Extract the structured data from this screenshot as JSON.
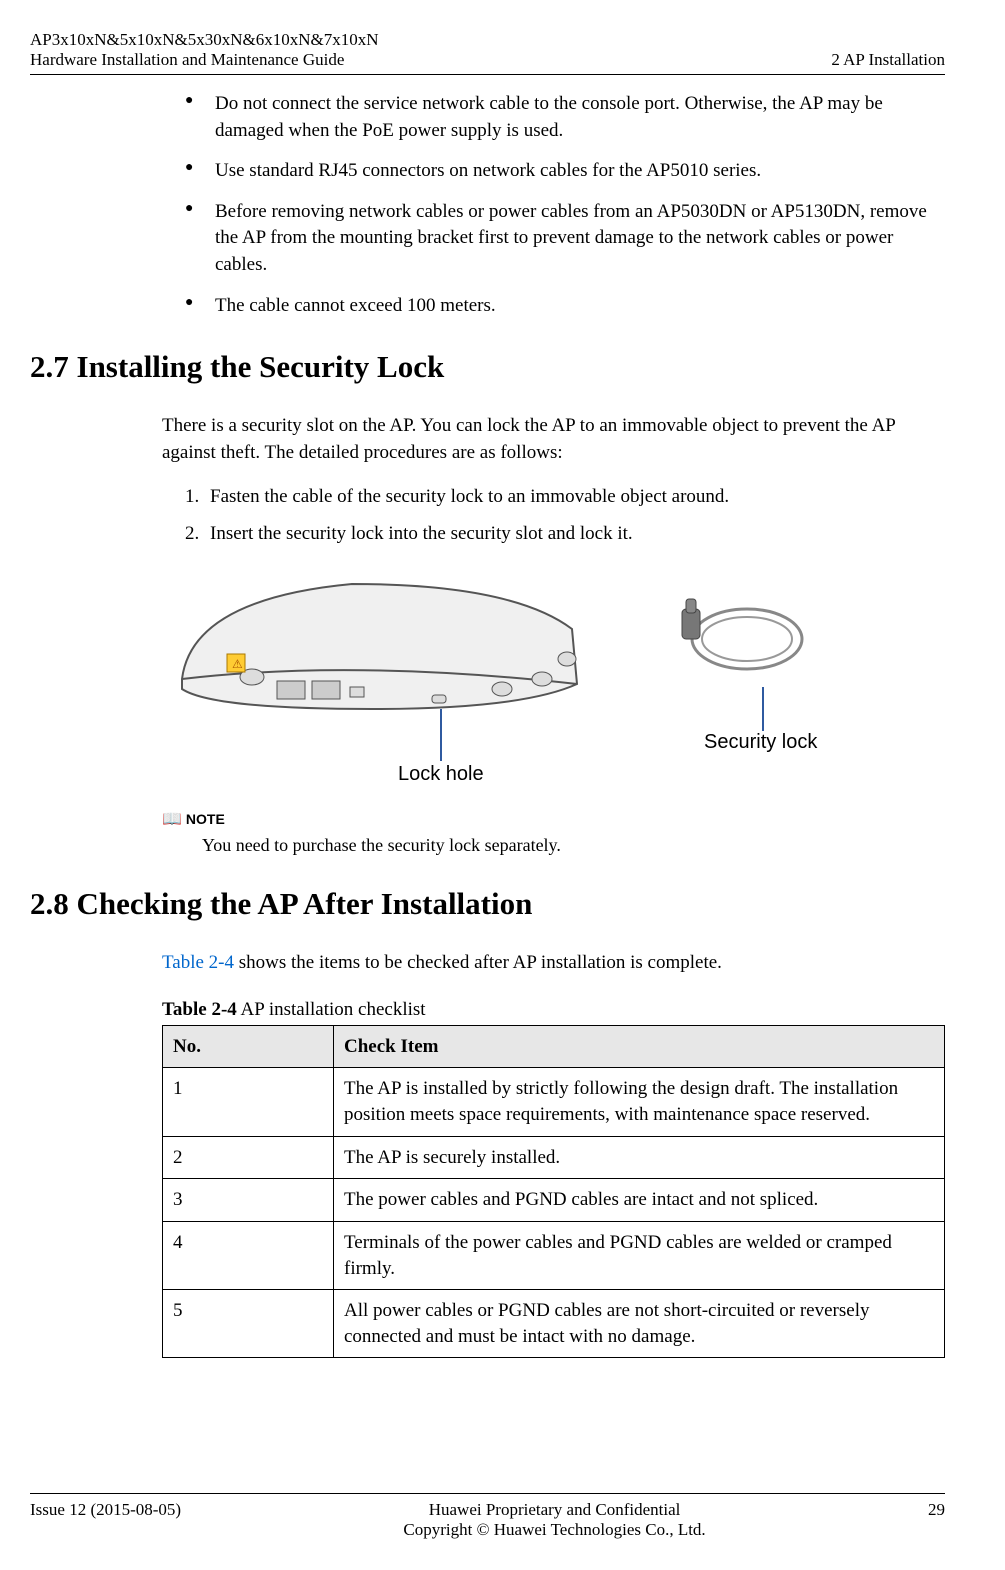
{
  "header": {
    "product_line1": "AP3x10xN&5x10xN&5x30xN&6x10xN&7x10xN",
    "product_line2": "Hardware Installation and Maintenance Guide",
    "section_label": "2 AP Installation"
  },
  "bullets": [
    "Do not connect the service network cable to the console port. Otherwise, the AP may be damaged when the PoE power supply is used.",
    "Use standard RJ45 connectors on network cables for the AP5010 series.",
    "Before removing network cables or power cables from an AP5030DN or AP5130DN, remove the AP from the mounting bracket first to prevent damage to the network cables or power cables.",
    "The cable cannot exceed 100 meters."
  ],
  "section27": {
    "title": "2.7 Installing the Security Lock",
    "intro": "There is a security slot on the AP. You can lock the AP to an immovable object to prevent the AP against theft. The detailed procedures are as follows:",
    "steps": [
      "Fasten the cable of the security lock to an immovable object around.",
      "Insert the security lock into the security slot and lock it."
    ],
    "figure": {
      "lock_hole_label": "Lock hole",
      "security_lock_label": "Security lock"
    },
    "note_label": "NOTE",
    "note_text": "You need to purchase the security lock separately."
  },
  "section28": {
    "title": "2.8 Checking the AP After Installation",
    "intro_prefix": "",
    "xref": "Table 2-4",
    "intro_suffix": " shows the items to be checked after AP installation is complete.",
    "table_caption_bold": "Table 2-4",
    "table_caption_rest": " AP installation checklist",
    "columns": {
      "no": "No.",
      "item": "Check Item"
    },
    "rows": [
      {
        "no": "1",
        "item": "The AP is installed by strictly following the design draft. The installation position meets space requirements, with maintenance space reserved."
      },
      {
        "no": "2",
        "item": "The AP is securely installed."
      },
      {
        "no": "3",
        "item": "The power cables and PGND cables are intact and not spliced."
      },
      {
        "no": "4",
        "item": "Terminals of the power cables and PGND cables are welded or cramped firmly."
      },
      {
        "no": "5",
        "item": "All power cables or PGND cables are not short-circuited or reversely connected and must be intact with no damage."
      }
    ]
  },
  "footer": {
    "issue": "Issue 12 (2015-08-05)",
    "center1": "Huawei Proprietary and Confidential",
    "center2": "Copyright © Huawei Technologies Co., Ltd.",
    "page": "29"
  }
}
